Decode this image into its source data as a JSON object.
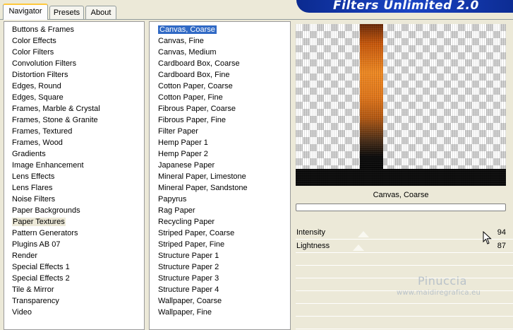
{
  "app": {
    "title": "Filters Unlimited 2.0"
  },
  "tabs": [
    {
      "label": "Navigator",
      "active": true
    },
    {
      "label": "Presets",
      "active": false
    },
    {
      "label": "About",
      "active": false
    }
  ],
  "categories": {
    "selected": "Paper Textures",
    "items": [
      "Buttons & Frames",
      "Color Effects",
      "Color Filters",
      "Convolution Filters",
      "Distortion Filters",
      "Edges, Round",
      "Edges, Square",
      "Frames, Marble & Crystal",
      "Frames, Stone & Granite",
      "Frames, Textured",
      "Frames, Wood",
      "Gradients",
      "Image Enhancement",
      "Lens Effects",
      "Lens Flares",
      "Noise Filters",
      "Paper Backgrounds",
      "Paper Textures",
      "Pattern Generators",
      "Plugins AB 07",
      "Render",
      "Special Effects 1",
      "Special Effects 2",
      "Tile & Mirror",
      "Transparency",
      "Video"
    ]
  },
  "filters": {
    "selected": "Canvas, Coarse",
    "items": [
      "Canvas, Coarse",
      "Canvas, Fine",
      "Canvas, Medium",
      "Cardboard Box, Coarse",
      "Cardboard Box, Fine",
      "Cotton Paper, Coarse",
      "Cotton Paper, Fine",
      "Fibrous Paper, Coarse",
      "Fibrous Paper, Fine",
      "Filter Paper",
      "Hemp Paper 1",
      "Hemp Paper 2",
      "Japanese Paper",
      "Mineral Paper, Limestone",
      "Mineral Paper, Sandstone",
      "Papyrus",
      "Rag Paper",
      "Recycling Paper",
      "Striped Paper, Coarse",
      "Striped Paper, Fine",
      "Structure Paper 1",
      "Structure Paper 2",
      "Structure Paper 3",
      "Structure Paper 4",
      "Wallpaper, Coarse",
      "Wallpaper, Fine"
    ]
  },
  "preview": {
    "filter_name": "Canvas, Coarse",
    "progress": 0
  },
  "sliders": [
    {
      "label": "Intensity",
      "value": "94",
      "max": 255
    },
    {
      "label": "Lightness",
      "value": "87",
      "max": 255
    }
  ],
  "watermark": {
    "name": "Pinuccia",
    "url": "www.maidiregrafica.eu"
  },
  "colors": {
    "selection": "#316ac5",
    "banner": "#1a44c4",
    "dialog_bg": "#ece9d8"
  }
}
